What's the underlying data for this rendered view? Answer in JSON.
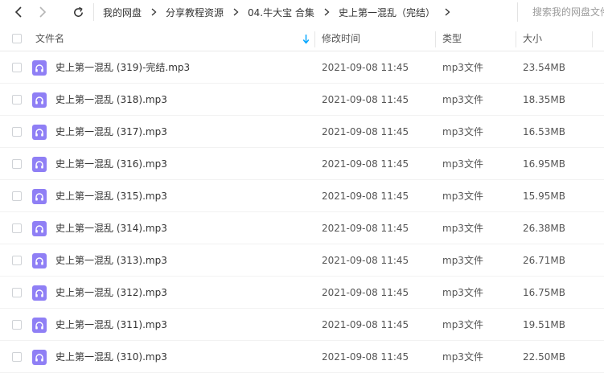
{
  "nav": {
    "back_icon": "chevron-left-icon",
    "forward_icon": "chevron-right-icon",
    "refresh_icon": "refresh-icon"
  },
  "breadcrumb": [
    "我的网盘",
    "分享教程资源",
    "04.牛大宝 合集",
    "史上第一混乱（完结）"
  ],
  "search": {
    "placeholder": "搜索我的网盘文件"
  },
  "columns": {
    "name": "文件名",
    "modified": "修改时间",
    "type": "类型",
    "size": "大小"
  },
  "sort_icon": "sort-down-arrow-icon",
  "colors": {
    "accent": "#06a7ff",
    "audio_icon": "#8f7ff5"
  },
  "files": [
    {
      "name": "史上第一混乱 (319)-完结.mp3",
      "modified": "2021-09-08 11:45",
      "type": "mp3文件",
      "size": "23.54MB"
    },
    {
      "name": "史上第一混乱 (318).mp3",
      "modified": "2021-09-08 11:45",
      "type": "mp3文件",
      "size": "18.35MB"
    },
    {
      "name": "史上第一混乱 (317).mp3",
      "modified": "2021-09-08 11:45",
      "type": "mp3文件",
      "size": "16.53MB"
    },
    {
      "name": "史上第一混乱 (316).mp3",
      "modified": "2021-09-08 11:45",
      "type": "mp3文件",
      "size": "16.95MB"
    },
    {
      "name": "史上第一混乱 (315).mp3",
      "modified": "2021-09-08 11:45",
      "type": "mp3文件",
      "size": "15.95MB"
    },
    {
      "name": "史上第一混乱 (314).mp3",
      "modified": "2021-09-08 11:45",
      "type": "mp3文件",
      "size": "26.38MB"
    },
    {
      "name": "史上第一混乱 (313).mp3",
      "modified": "2021-09-08 11:45",
      "type": "mp3文件",
      "size": "26.71MB"
    },
    {
      "name": "史上第一混乱 (312).mp3",
      "modified": "2021-09-08 11:45",
      "type": "mp3文件",
      "size": "16.75MB"
    },
    {
      "name": "史上第一混乱 (311).mp3",
      "modified": "2021-09-08 11:45",
      "type": "mp3文件",
      "size": "19.51MB"
    },
    {
      "name": "史上第一混乱 (310).mp3",
      "modified": "2021-09-08 11:45",
      "type": "mp3文件",
      "size": "22.50MB"
    }
  ]
}
